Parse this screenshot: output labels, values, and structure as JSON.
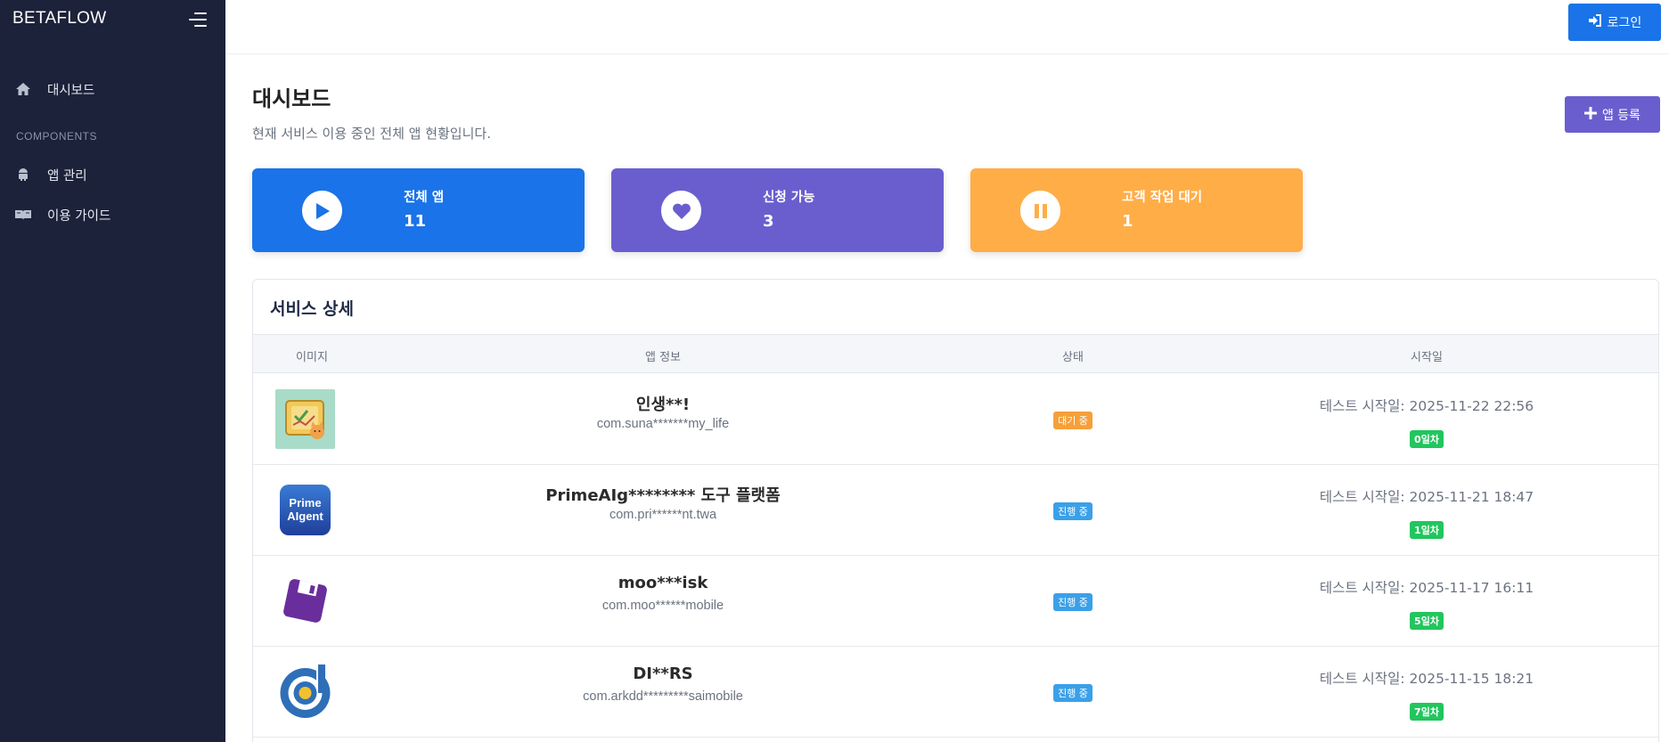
{
  "sidebar": {
    "brand": "BETAFLOW",
    "items": [
      {
        "label": "대시보드",
        "icon": "home-icon"
      },
      {
        "label": "앱 관리",
        "icon": "android-icon"
      },
      {
        "label": "이용 가이드",
        "icon": "book-icon"
      }
    ],
    "section_label": "COMPONENTS"
  },
  "topbar": {
    "login_label": "로그인"
  },
  "header": {
    "title": "대시보드",
    "subtitle": "현재 서비스 이용 중인 전체 앱 현황입니다.",
    "add_app_label": "앱 등록"
  },
  "stats": [
    {
      "label": "전체 앱",
      "value": "11",
      "color": "#1a73e8",
      "icon": "play-icon"
    },
    {
      "label": "신청 가능",
      "value": "3",
      "color": "#6a5ecf",
      "icon": "heart-icon"
    },
    {
      "label": "고객 작업 대기",
      "value": "1",
      "color": "#ffad47",
      "icon": "pause-icon"
    }
  ],
  "detail": {
    "title": "서비스 상세",
    "columns": [
      "이미지",
      "앱 정보",
      "상태",
      "시작일"
    ],
    "rows": [
      {
        "name": "인생**!",
        "package": "com.suna*******my_life",
        "status": "대기 중",
        "status_color": "#f5a03a",
        "start": "테스트 시작일: 2025-11-22 22:56",
        "day": "0일차",
        "icon": "checklist-cat-icon"
      },
      {
        "name": "PrimeAIg******** 도구 플랫폼",
        "package": "com.pri******nt.twa",
        "status": "진행 중",
        "status_color": "#3aa0e8",
        "start": "테스트 시작일: 2025-11-21 18:47",
        "day": "1일차",
        "icon": "prime-aigent-icon",
        "icon_text": [
          "Prime",
          "AIgent"
        ]
      },
      {
        "name": "moo***isk",
        "package": "com.moo******mobile",
        "status": "진행 중",
        "status_color": "#3aa0e8",
        "start": "테스트 시작일: 2025-11-17 16:11",
        "day": "5일차",
        "icon": "purple-disk-icon"
      },
      {
        "name": "DI**RS",
        "package": "com.arkdd*********saimobile",
        "status": "진행 중",
        "status_color": "#3aa0e8",
        "start": "테스트 시작일: 2025-11-15 18:21",
        "day": "7일차",
        "icon": "d-logo-icon"
      }
    ]
  }
}
